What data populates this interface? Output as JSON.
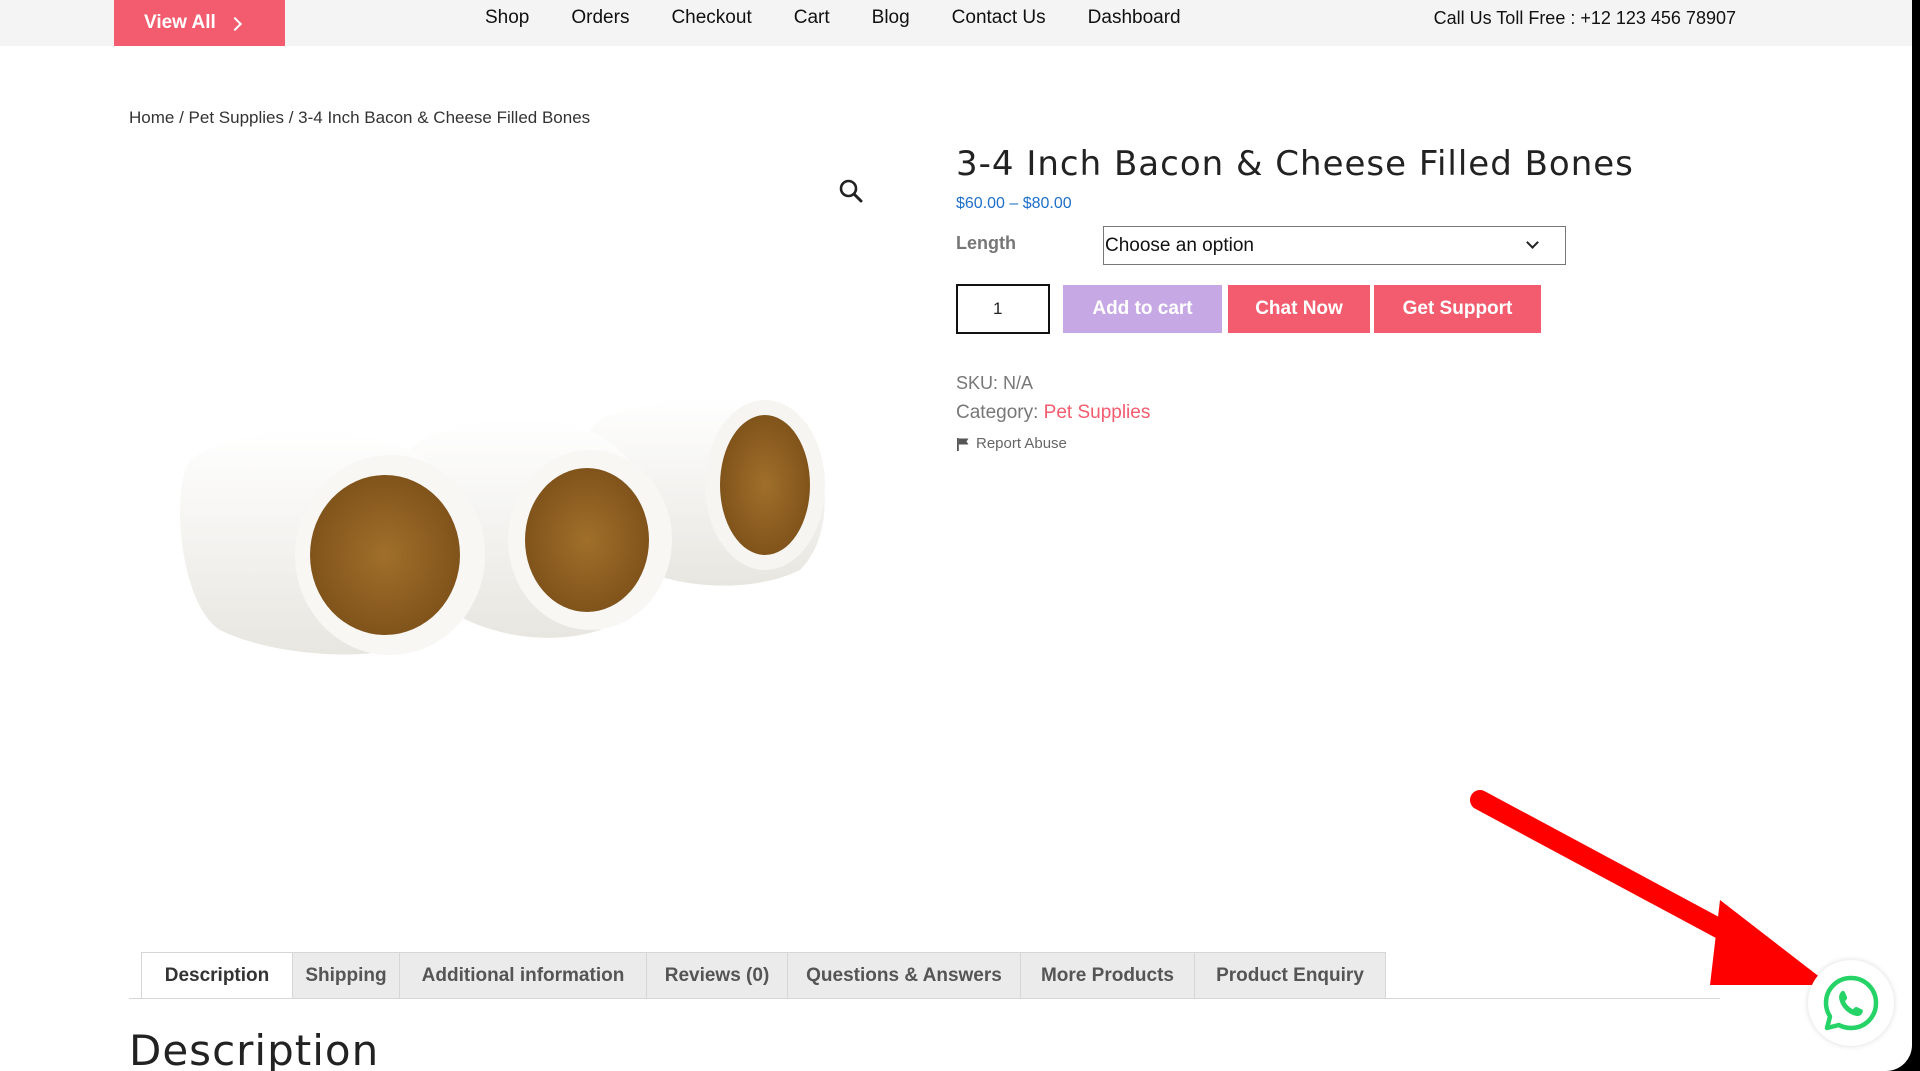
{
  "topbar": {
    "view_all_label": "View All",
    "nav": [
      "Shop",
      "Orders",
      "Checkout",
      "Cart",
      "Blog",
      "Contact Us",
      "Dashboard"
    ],
    "toll_free": "Call Us Toll Free : +12 123 456 78907"
  },
  "breadcrumb": {
    "home": "Home",
    "sep1": " / ",
    "category": "Pet Supplies",
    "sep2": " / ",
    "current": "3-4 Inch Bacon & Cheese Filled Bones"
  },
  "product": {
    "title": "3-4 Inch Bacon & Cheese Filled Bones",
    "price": "$60.00 – $80.00",
    "length_label": "Length",
    "length_select_value": "Choose an option",
    "quantity": "1",
    "add_to_cart": "Add to cart",
    "chat_now": "Chat Now",
    "get_support": "Get Support",
    "sku": "SKU: N/A",
    "category_label": "Category: ",
    "category_link": "Pet Supplies",
    "report_abuse": "Report Abuse"
  },
  "tabs": [
    {
      "label": "Description",
      "active": true
    },
    {
      "label": "Shipping"
    },
    {
      "label": "Additional information"
    },
    {
      "label": "Reviews (0)"
    },
    {
      "label": "Questions & Answers"
    },
    {
      "label": "More Products"
    },
    {
      "label": "Product Enquiry"
    }
  ],
  "description_heading": "Description",
  "colors": {
    "accent": "#f25c6e",
    "add_to_cart": "#c6a9e4",
    "price": "#1e6fc9",
    "whatsapp": "#25d366",
    "arrow": "#ff0000"
  },
  "icons": [
    "chevron-right-icon",
    "search-icon",
    "flag-icon",
    "chevron-down-icon",
    "whatsapp-icon"
  ]
}
